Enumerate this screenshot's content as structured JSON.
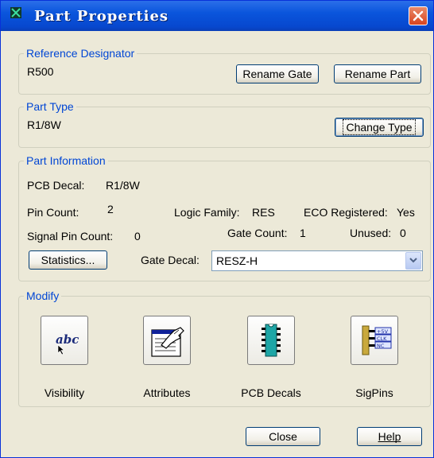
{
  "window": {
    "title": "Part Properties"
  },
  "reference": {
    "legend": "Reference Designator",
    "value": "R500",
    "rename_gate": "Rename Gate",
    "rename_part": "Rename Part"
  },
  "part_type": {
    "legend": "Part Type",
    "value": "R1/8W",
    "change_type": "Change Type"
  },
  "info": {
    "legend": "Part Information",
    "pcb_decal_label": "PCB Decal:",
    "pcb_decal_value": "R1/8W",
    "pin_count_label": "Pin Count:",
    "pin_count_value": "2",
    "logic_family_label": "Logic Family:",
    "logic_family_value": "RES",
    "eco_label": "ECO Registered:",
    "eco_value": "Yes",
    "signal_pin_label": "Signal Pin Count:",
    "signal_pin_value": "0",
    "gate_count_label": "Gate Count:",
    "gate_count_value": "1",
    "unused_label": "Unused:",
    "unused_value": "0",
    "statistics": "Statistics...",
    "gate_decal_label": "Gate Decal:",
    "gate_decal_value": "RESZ-H"
  },
  "modify": {
    "legend": "Modify",
    "buttons": [
      {
        "label": "Visibility",
        "icon": "abc-visibility-icon"
      },
      {
        "label": "Attributes",
        "icon": "attributes-hand-icon"
      },
      {
        "label": "PCB Decals",
        "icon": "ic-chip-icon"
      },
      {
        "label": "SigPins",
        "icon": "signal-pins-icon"
      }
    ],
    "sigpin_tags": [
      "+5V",
      "CLK",
      "NC"
    ],
    "abc_text": "abc"
  },
  "footer": {
    "close": "Close",
    "help": "Help"
  }
}
